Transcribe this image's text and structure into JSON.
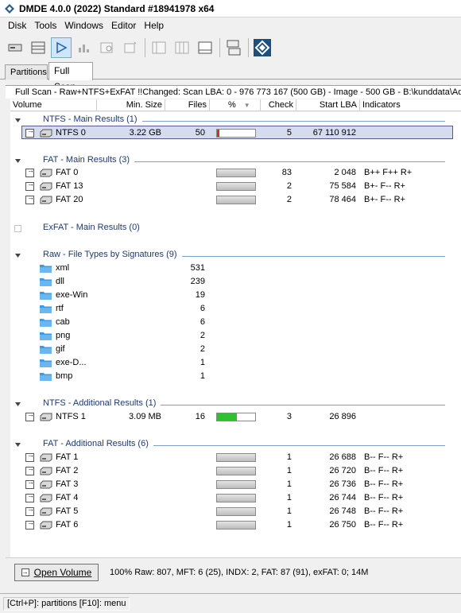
{
  "window": {
    "title": "DMDE 4.0.0 (2022) Standard #18941978 x64"
  },
  "menu": [
    "Disk",
    "Tools",
    "Windows",
    "Editor",
    "Help"
  ],
  "tabs": [
    {
      "label": "Partitions",
      "selected": false
    },
    {
      "label": "Full Scan",
      "selected": true
    }
  ],
  "infobar": {
    "text": "Full Scan - Raw+NTFS+ExFAT !!Changed: Scan LBA: 0 - 976 773 167 (500 GB) - Image - 500 GB - B:\\kunddata\\Ad"
  },
  "columns": {
    "volume": "Volume",
    "min_size": "Min. Size",
    "files": "Files",
    "percent": "%",
    "check": "Check",
    "start_lba": "Start LBA",
    "indicators": "Indicators"
  },
  "groups": {
    "ntfs_main": "NTFS - Main Results (1)",
    "fat_main": "FAT - Main Results (3)",
    "exfat_main": "ExFAT - Main Results (0)",
    "raw": "Raw - File Types by Signatures (9)",
    "ntfs_add": "NTFS - Additional Results (1)",
    "fat_add": "FAT - Additional Results (6)"
  },
  "ntfs_main_rows": [
    {
      "name": "NTFS 0",
      "size": "3.22 GB",
      "files": "50",
      "percent": 0.06,
      "bar_color": "#d03030",
      "check": "5",
      "lba": "67 110 912",
      "ind": ""
    }
  ],
  "fat_main_rows": [
    {
      "name": "FAT 0",
      "check": "83",
      "lba": "2 048",
      "ind": "B++ F++ R+"
    },
    {
      "name": "FAT 13",
      "check": "2",
      "lba": "75 584",
      "ind": "B+- F-- R+"
    },
    {
      "name": "FAT 20",
      "check": "2",
      "lba": "78 464",
      "ind": "B+- F-- R+"
    }
  ],
  "raw_rows": [
    {
      "name": "xml",
      "files": "531"
    },
    {
      "name": "dll",
      "files": "239"
    },
    {
      "name": "exe-Win",
      "files": "19"
    },
    {
      "name": "rtf",
      "files": "6"
    },
    {
      "name": "cab",
      "files": "6"
    },
    {
      "name": "png",
      "files": "2"
    },
    {
      "name": "gif",
      "files": "2"
    },
    {
      "name": "exe-D...",
      "files": "1"
    },
    {
      "name": "bmp",
      "files": "1"
    }
  ],
  "ntfs_add_rows": [
    {
      "name": "NTFS 1",
      "size": "3.09 MB",
      "files": "16",
      "percent": 0.52,
      "bar_color": "#30c030",
      "check": "3",
      "lba": "26 896",
      "ind": ""
    }
  ],
  "fat_add_rows": [
    {
      "name": "FAT 1",
      "check": "1",
      "lba": "26 688",
      "ind": "B-- F-- R+"
    },
    {
      "name": "FAT 2",
      "check": "1",
      "lba": "26 720",
      "ind": "B-- F-- R+"
    },
    {
      "name": "FAT 3",
      "check": "1",
      "lba": "26 736",
      "ind": "B-- F-- R+"
    },
    {
      "name": "FAT 4",
      "check": "1",
      "lba": "26 744",
      "ind": "B-- F-- R+"
    },
    {
      "name": "FAT 5",
      "check": "1",
      "lba": "26 748",
      "ind": "B-- F-- R+"
    },
    {
      "name": "FAT 6",
      "check": "1",
      "lba": "26 750",
      "ind": "B-- F-- R+"
    }
  ],
  "footer": {
    "open_button": "Open Volume",
    "status": "100% Raw: 807, MFT: 6 (25), INDX: 2, FAT: 87 (91), exFAT: 0; 14M"
  },
  "statusbar": {
    "text": "[Ctrl+P]: partitions  [F10]: menu"
  },
  "colors": {
    "group_title": "#1e3a6e",
    "group_line": "#7f9fcf",
    "selected_row": "#d6dcf0",
    "folder": "#3c9be8"
  }
}
